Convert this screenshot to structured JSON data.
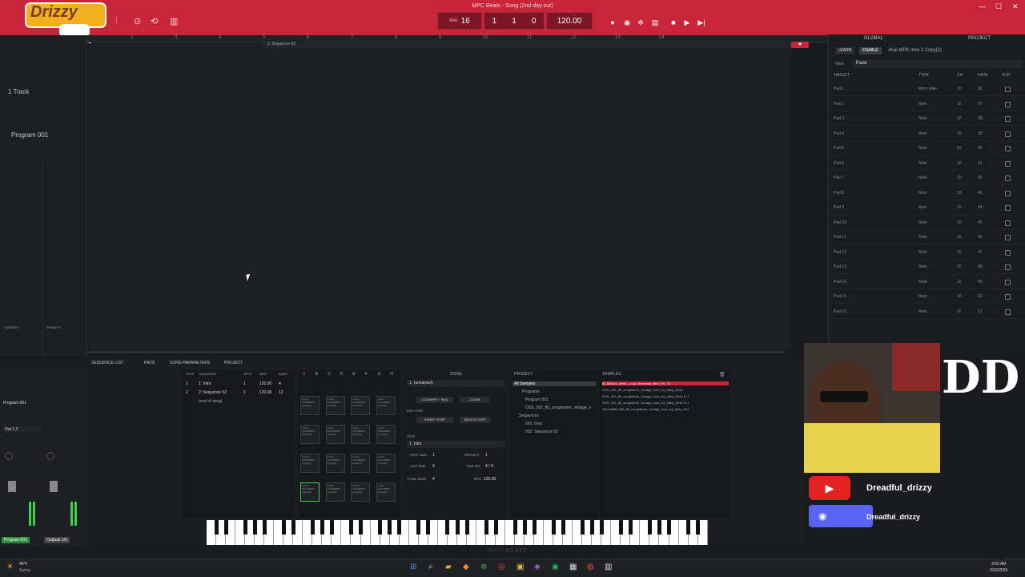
{
  "window": {
    "title": "MPC Beats - Song (2nd day out)"
  },
  "stream_logo": "Drizzy",
  "transport": {
    "tempo": "120.00",
    "position_bars": "1",
    "position_beats": "1",
    "position_ticks": "0",
    "counter_value": "16",
    "counter_label": "BAR"
  },
  "ruler": [
    "2",
    "3",
    "4",
    "5",
    "6",
    "7",
    "8",
    "9",
    "10",
    "11",
    "12",
    "13",
    "14"
  ],
  "sequence_clip": "2: Sequence 02",
  "left_panel": {
    "track_label": "1 Track",
    "program_label": "Program 001",
    "inserts_left": "INSERTS",
    "inserts_right": "INSERTS"
  },
  "right_panel": {
    "tab_global": "GLOBAL",
    "tab_project": "PROJECT",
    "learn_btn": "LEARN",
    "enable_btn": "ENABLE",
    "device_name": "Akai MPK mini 3 Copy(2)",
    "view_label": "View",
    "view_value": "Pads",
    "headers": [
      "TARGET",
      "TYPE",
      "CH",
      "DATA",
      "FLIP"
    ],
    "rows": [
      {
        "target": "Pad 1",
        "type": "Mom.ulten",
        "ch": "10",
        "data": "36"
      },
      {
        "target": "Pad 2",
        "type": "Note",
        "ch": "10",
        "data": "37"
      },
      {
        "target": "Pad 3",
        "type": "Note",
        "ch": "10",
        "data": "38"
      },
      {
        "target": "Pad 4",
        "type": "Note",
        "ch": "10",
        "data": "39"
      },
      {
        "target": "Pad 5",
        "type": "Note",
        "ch": "10",
        "data": "40"
      },
      {
        "target": "Pad 6",
        "type": "Note",
        "ch": "10",
        "data": "41"
      },
      {
        "target": "Pad 7",
        "type": "Note",
        "ch": "10",
        "data": "42"
      },
      {
        "target": "Pad 8",
        "type": "Note",
        "ch": "10",
        "data": "43"
      },
      {
        "target": "Pad 9",
        "type": "Note",
        "ch": "10",
        "data": "44"
      },
      {
        "target": "Pad 10",
        "type": "Note",
        "ch": "10",
        "data": "45"
      },
      {
        "target": "Pad 11",
        "type": "Note",
        "ch": "10",
        "data": "46"
      },
      {
        "target": "Pad 12",
        "type": "Note",
        "ch": "10",
        "data": "47"
      },
      {
        "target": "Pad 13",
        "type": "Note",
        "ch": "10",
        "data": "48"
      },
      {
        "target": "Pad 14",
        "type": "Note",
        "ch": "10",
        "data": "49"
      },
      {
        "target": "Pad 15",
        "type": "Note",
        "ch": "10",
        "data": "50"
      },
      {
        "target": "Pad 16",
        "type": "Note",
        "ch": "10",
        "data": "51"
      }
    ]
  },
  "bottom_tabs": [
    "SEQUENCE LIST",
    "PADS",
    "SONG PARAMETERS",
    "PROJECT"
  ],
  "song": {
    "headers": [
      "STEP",
      "SEQUENCE",
      "RPTS",
      "BPM",
      "BARS"
    ],
    "rows": [
      {
        "step": "1",
        "seq": "1: Intro",
        "rpts": "1",
        "bpm": "120.00",
        "bars": "4"
      },
      {
        "step": "2",
        "seq": "2: Sequence 02",
        "rpts": "1",
        "bpm": "120.00",
        "bars": "12"
      }
    ],
    "end": "(end of song)"
  },
  "pad_banks": [
    "A",
    "B",
    "C",
    "D",
    "E",
    "F",
    "G",
    "H"
  ],
  "pad_text": "1 bars 120.00BPM (unused)",
  "step_ctl": {
    "song_label": "SONG",
    "song_value": "1: (unnamed)",
    "convert": "CONVERT > SEQ",
    "clear": "CLEAR",
    "edit_step": "EDIT STEP",
    "insert": "INSERT STEP",
    "delete": "DELETE STEP",
    "step_label": "STEP",
    "step_value": "1: Intro",
    "first_bar_label": "FIRST BAR",
    "first_bar": "1",
    "repeats_label": "REPEATS",
    "repeats": "1",
    "last_bar_label": "LAST BAR",
    "last_bar": "4",
    "timesig_label": "TIME SIG",
    "timesig": "4 / 4",
    "total_bars_label": "TOTAL BARS",
    "total_bars": "4",
    "bpm_label": "BPM",
    "bpm": "120.00"
  },
  "project": {
    "title": "PROJECT",
    "items": [
      "All Samples",
      "Programs",
      "Program 001",
      "OSS_092_86_songstarter_vintage_s",
      "Sequences",
      "001: Intro",
      "002: Sequence 02"
    ]
  },
  "samples": {
    "title": "SAMPLES",
    "items": [
      "Bl_2020r4_VerbL_Loop_Reversed_Bmr_FX_72",
      "OSS_092_86_songstarter_vintage_soul_my_baby_Emin",
      "OSS_092_86_songstarter_vintage_soul_my_baby_Emin R-1",
      "OSS_092_86_songstarter_vintage_soul_my_baby_Emin R-1",
      "Slicedl088_092_86_songstarter_vintage_soul_my_baby_Emi"
    ]
  },
  "mixer": {
    "program": "Program 001",
    "out": "Out 1,2",
    "ch1": "Program 001",
    "ch2": "Outputs 1/2"
  },
  "footer_brand": "MPC BEATS",
  "social": {
    "youtube": "Dreadful_drizzy",
    "discord": "Dreadful_drizzy"
  },
  "webcam_logo": "DD",
  "taskbar": {
    "weather_temp": "48°F",
    "weather_desc": "Sunny",
    "time": "3:50 AM",
    "date": "3/16/2026"
  }
}
